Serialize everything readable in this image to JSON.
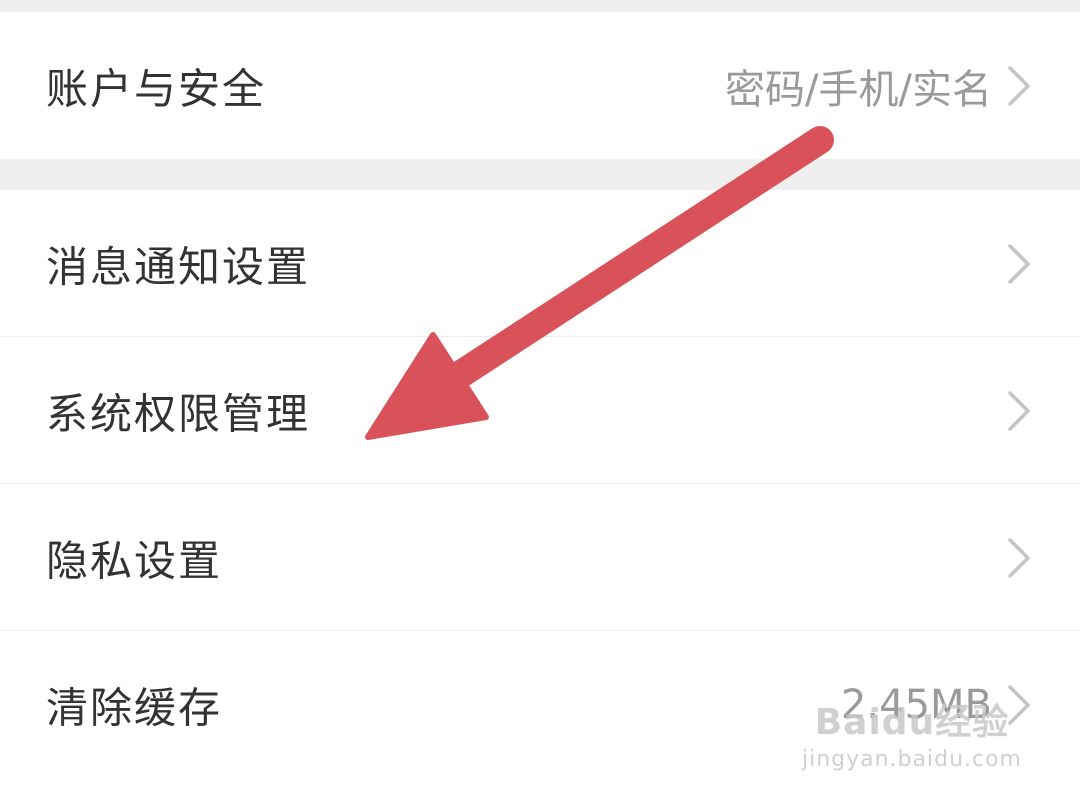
{
  "settings": {
    "items": [
      {
        "label": "账户与安全",
        "value": "密码/手机/实名"
      },
      {
        "label": "消息通知设置",
        "value": ""
      },
      {
        "label": "系统权限管理",
        "value": ""
      },
      {
        "label": "隐私设置",
        "value": ""
      },
      {
        "label": "清除缓存",
        "value": "2.45MB"
      }
    ]
  },
  "watermark": {
    "logo_text": "Baidu经验",
    "url": "jingyan.baidu.com"
  },
  "colors": {
    "arrow": "#d9525a",
    "label_text": "#333333",
    "value_text": "#9a9a9a",
    "chevron": "#c4c4c4",
    "background": "#f2f2f2",
    "card": "#ffffff"
  },
  "icons": {
    "chevron": "chevron-right-icon",
    "annotation": "red-arrow-annotation"
  }
}
